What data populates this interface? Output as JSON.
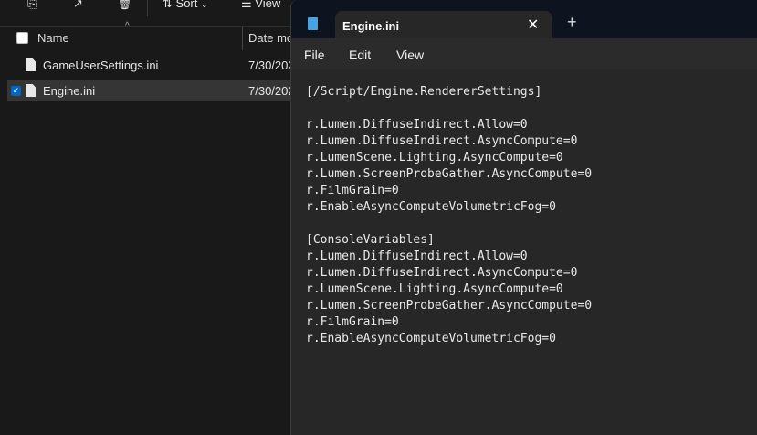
{
  "explorer": {
    "toolbar": {
      "sort_label": "Sort",
      "view_label": "View"
    },
    "columns": {
      "name": "Name",
      "date": "Date mo"
    },
    "files": [
      {
        "name": "GameUserSettings.ini",
        "date": "7/30/202",
        "selected": false
      },
      {
        "name": "Engine.ini",
        "date": "7/30/202",
        "selected": true
      }
    ]
  },
  "notepad": {
    "tab_title": "Engine.ini",
    "menu": [
      "File",
      "Edit",
      "View"
    ],
    "lines": [
      "[/Script/Engine.RendererSettings]",
      "",
      "r.Lumen.DiffuseIndirect.Allow=0",
      "r.Lumen.DiffuseIndirect.AsyncCompute=0",
      "r.LumenScene.Lighting.AsyncCompute=0",
      "r.Lumen.ScreenProbeGather.AsyncCompute=0",
      "r.FilmGrain=0",
      "r.EnableAsyncComputeVolumetricFog=0",
      "",
      "[ConsoleVariables]",
      "r.Lumen.DiffuseIndirect.Allow=0",
      "r.Lumen.DiffuseIndirect.AsyncCompute=0",
      "r.LumenScene.Lighting.AsyncCompute=0",
      "r.Lumen.ScreenProbeGather.AsyncCompute=0",
      "r.FilmGrain=0",
      "r.EnableAsyncComputeVolumetricFog=0"
    ]
  },
  "colors": {
    "accent": "#0067c0",
    "titlebar": "#0e1320",
    "editor_bg": "#272727"
  }
}
